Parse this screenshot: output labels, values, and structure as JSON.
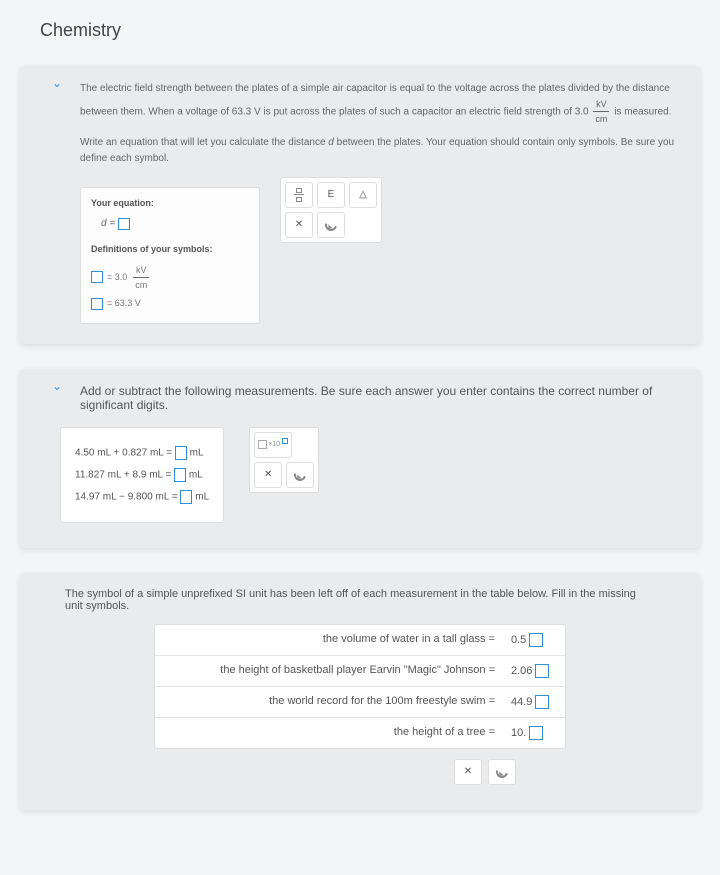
{
  "pageTitle": "Chemistry",
  "card1": {
    "p1a": "The electric field strength between the plates of a simple air capacitor is equal to the voltage across the plates divided by the distance between them. When a voltage of 63.3 V is put across the plates of such a capacitor an electric field strength of 3.0",
    "fracNum": "kV",
    "fracDen": "cm",
    "p1b": "is measured.",
    "p2a": "Write an equation that will let you calculate the distance ",
    "p2var": "d",
    "p2b": " between the plates. Your equation should contain only symbols. Be sure you define each symbol.",
    "eqLabel": "Your equation:",
    "eqLhs": "d =",
    "defLabel": "Definitions of your symbols:",
    "def1num": "kV",
    "def1den": "cm",
    "def1val": "= 3.0",
    "def2val": "= 63.3 V",
    "tools": {
      "e": "E",
      "triangle": "△",
      "x": "✕"
    }
  },
  "card2": {
    "prompt": "Add or subtract the following measurements. Be sure each answer you enter contains the correct number of significant digits.",
    "rows": [
      {
        "expr": "4.50 mL + 0.827 mL  =",
        "unit": "mL"
      },
      {
        "expr": "11.827 mL + 8.9 mL  =",
        "unit": "mL"
      },
      {
        "expr": "14.97 mL − 9.800 mL  =",
        "unit": "mL"
      }
    ],
    "sciLabel": "×10",
    "x": "✕"
  },
  "card3": {
    "prompt": "The symbol of a simple unprefixed SI unit has been left off of each measurement in the table below. Fill in the missing unit symbols.",
    "rows": [
      {
        "label": "the volume of water in a tall glass =",
        "val": "0.5"
      },
      {
        "label": "the height of basketball player Earvin \"Magic\" Johnson =",
        "val": "2.06"
      },
      {
        "label": "the world record for the 100m freestyle swim =",
        "val": "44.9"
      },
      {
        "label": "the height of a tree =",
        "val": "10."
      }
    ],
    "x": "✕"
  }
}
